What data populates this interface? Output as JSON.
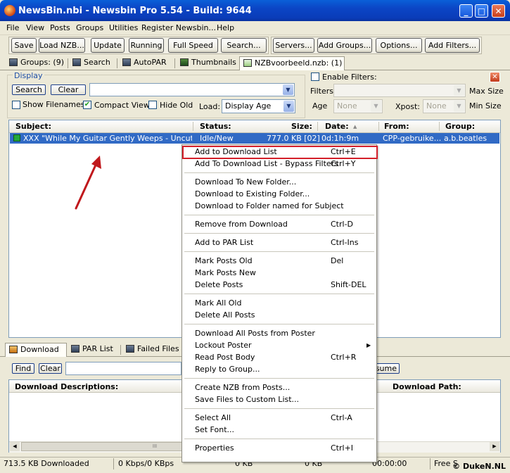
{
  "window": {
    "title": "NewsBin.nbi - Newsbin Pro 5.54 - Build: 9644",
    "min": "_",
    "max": "□",
    "close": "✕"
  },
  "menu": [
    "File",
    "View",
    "Posts",
    "Groups",
    "Utilities",
    "Register Newsbin...",
    "Help"
  ],
  "toolbar": {
    "save": "Save",
    "load_nzb": "Load NZB...",
    "update": "Update",
    "running": "Running",
    "full_speed": "Full Speed",
    "search": "Search...",
    "servers": "Servers...",
    "add_groups": "Add Groups...",
    "options": "Options...",
    "add_filters": "Add Filters..."
  },
  "tabs": {
    "groups": "Groups: (9)",
    "search": "Search",
    "autopar": "AutoPAR",
    "thumbnails": "Thumbnails",
    "nzb": "NZBvoorbeeld.nzb: (1)"
  },
  "display": {
    "legend": "Display",
    "search_btn": "Search",
    "clear_btn": "Clear",
    "search_value": "",
    "show_filenames": "Show Filenames:",
    "compact_view": "Compact View",
    "hide_old": "Hide Old",
    "load_label": "Load:",
    "load_value": "Display Age"
  },
  "filters": {
    "enable_filters": "Enable Filters:",
    "filters_label": "Filters:",
    "max_size": "Max Size",
    "age_label": "Age",
    "age_value": "None",
    "xpost_label": "Xpost:",
    "xpost_value": "None",
    "min_size": "Min Size"
  },
  "list": {
    "columns": {
      "subject": "Subject:",
      "status": "Status:",
      "size": "Size:",
      "date": "Date:",
      "from": "From:",
      "group": "Group:"
    },
    "row": {
      "subject": "XXX \"While My Guitar Gently Weeps - Uncut - di...",
      "status": "Idle/New",
      "size": "777.0 KB [02]",
      "date": "0d:1h:9m",
      "from": "CPP-gebruike...",
      "group": "a.b.beatles"
    }
  },
  "context_menu": [
    {
      "label": "Add to Download List",
      "shortcut": "Ctrl+E"
    },
    {
      "label": "Add To Download List - Bypass Filters",
      "shortcut": "Ctrl+Y"
    },
    {
      "label": "Download To New Folder...",
      "shortcut": ""
    },
    {
      "label": "Download to Existing Folder...",
      "shortcut": ""
    },
    {
      "label": "Download to Folder named for Subject",
      "shortcut": ""
    },
    {
      "label": "Remove from Download",
      "shortcut": "Ctrl-D"
    },
    {
      "label": "Add to PAR List",
      "shortcut": "Ctrl-Ins"
    },
    {
      "label": "Mark Posts Old",
      "shortcut": "Del"
    },
    {
      "label": "Mark Posts New",
      "shortcut": ""
    },
    {
      "label": "Delete Posts",
      "shortcut": "Shift-DEL"
    },
    {
      "label": "Mark All Old",
      "shortcut": ""
    },
    {
      "label": "Delete All Posts",
      "shortcut": ""
    },
    {
      "label": "Download All Posts from Poster",
      "shortcut": ""
    },
    {
      "label": "Lockout Poster",
      "shortcut": ""
    },
    {
      "label": "Read Post Body",
      "shortcut": "Ctrl+R"
    },
    {
      "label": "Reply to Group...",
      "shortcut": ""
    },
    {
      "label": "Create NZB from Posts...",
      "shortcut": ""
    },
    {
      "label": "Save Files to Custom List...",
      "shortcut": ""
    },
    {
      "label": "Select All",
      "shortcut": "Ctrl-A"
    },
    {
      "label": "Set Font...",
      "shortcut": ""
    },
    {
      "label": "Properties",
      "shortcut": "Ctrl+I"
    }
  ],
  "bottom": {
    "tabs": {
      "download": "Download",
      "par_list": "PAR List",
      "failed_files": "Failed Files"
    },
    "find_btn": "Find",
    "clear_btn": "Clear",
    "resume_btn": "sume",
    "columns": {
      "descriptions": "Download Descriptions:",
      "path": "Download Path:"
    },
    "scroll_grip": "III"
  },
  "status": {
    "downloaded": "713.5 KB Downloaded",
    "speed": "0 Kbps/0 KBps",
    "kb": "0 KB",
    "kb2": "0 KB",
    "time": "00:00:00",
    "free": "Free S"
  },
  "watermark": "© DukeN.NL",
  "colors": {
    "selection": "#316ac5",
    "highlight_box": "#d4202a",
    "arrow": "#c0181c",
    "titlebar": "#0a4fd0"
  }
}
